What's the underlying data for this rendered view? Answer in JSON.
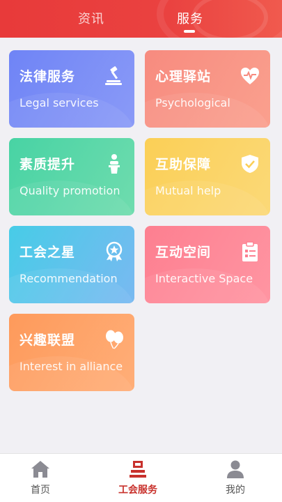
{
  "header": {
    "tabs": [
      {
        "label": "资讯",
        "active": false
      },
      {
        "label": "服务",
        "active": true
      }
    ]
  },
  "services": [
    {
      "cn": "法律服务",
      "en": "Legal services",
      "icon": "gavel-icon"
    },
    {
      "cn": "心理驿站",
      "en": "Psychological",
      "icon": "heart-pulse-icon"
    },
    {
      "cn": "素质提升",
      "en": "Quality promotion",
      "icon": "podium-speaker-icon"
    },
    {
      "cn": "互助保障",
      "en": "Mutual help",
      "icon": "shield-check-icon"
    },
    {
      "cn": "工会之星",
      "en": "Recommendation",
      "icon": "star-medal-icon"
    },
    {
      "cn": "互动空间",
      "en": "Interactive Space",
      "icon": "clipboard-icon"
    },
    {
      "cn": "兴趣联盟",
      "en": "Interest in alliance",
      "icon": "balloons-icon"
    }
  ],
  "bottom_nav": [
    {
      "label": "首页",
      "icon": "home-icon",
      "active": false
    },
    {
      "label": "工会服务",
      "icon": "union-service-icon",
      "active": true
    },
    {
      "label": "我的",
      "icon": "user-icon",
      "active": false
    }
  ],
  "colors": {
    "header_red": "#e83a3a",
    "active_nav": "#c8312c",
    "legal": "#6f84f6",
    "psychological": "#f78b7f",
    "quality": "#48d3a4",
    "mutual": "#fbcf56",
    "recommendation": "#47cce7",
    "interactive": "#fd7f90",
    "interest": "#fe9a5b"
  }
}
